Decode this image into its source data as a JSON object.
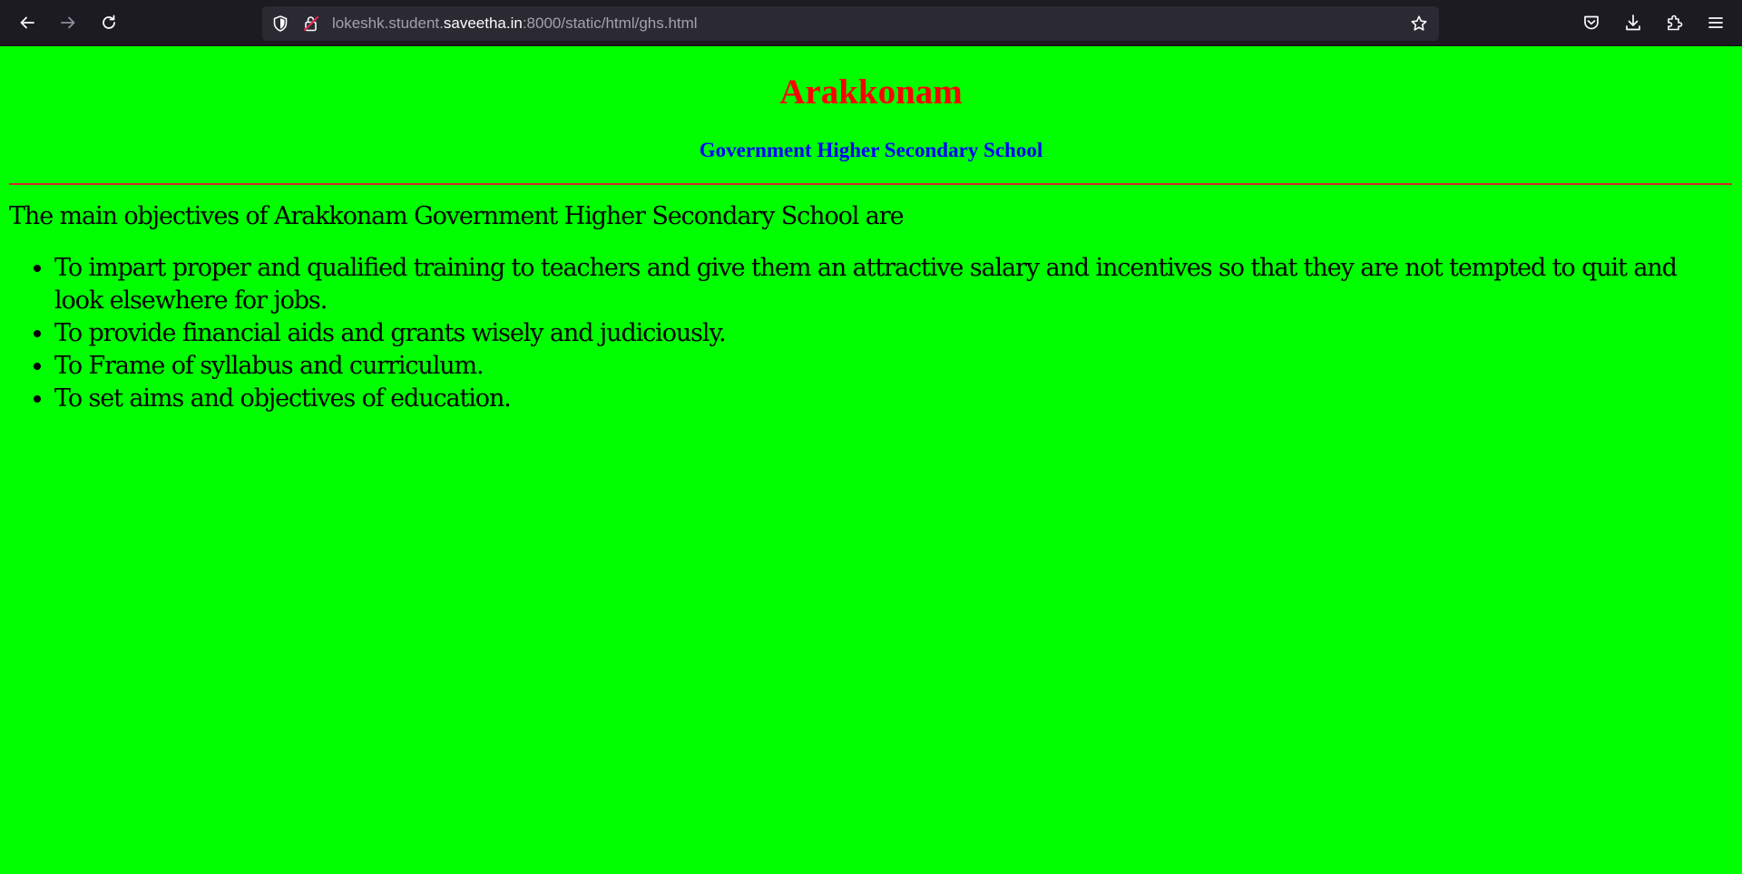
{
  "browser": {
    "url_prefix": "lokeshk.student.",
    "url_domain": "saveetha.in",
    "url_suffix": ":8000/static/html/ghs.html",
    "icons": {
      "back": "back-arrow-icon",
      "forward": "forward-arrow-icon",
      "reload": "reload-icon",
      "tracking_protection": "shield-icon",
      "connection": "insecure-lock-icon",
      "bookmark": "star-icon",
      "pocket": "pocket-icon",
      "downloads": "download-icon",
      "extensions": "puzzle-icon",
      "menu": "hamburger-menu-icon"
    }
  },
  "page": {
    "background_color": "#00ff00",
    "title": "Arakkonam",
    "title_color": "#ff0000",
    "subtitle": "Government Higher Secondary School",
    "subtitle_color": "#0000ff",
    "divider_color": "#d22a2a",
    "intro": "The main objectives of Arakkonam Government Higher Secondary School are",
    "objectives": [
      "To impart proper and qualified training to teachers and give them an attractive salary and incentives so that they are not tempted to quit and look elsewhere for jobs.",
      "To provide financial aids and grants wisely and judiciously.",
      "To Frame of syllabus and curriculum.",
      "To set aims and objectives of education."
    ]
  }
}
